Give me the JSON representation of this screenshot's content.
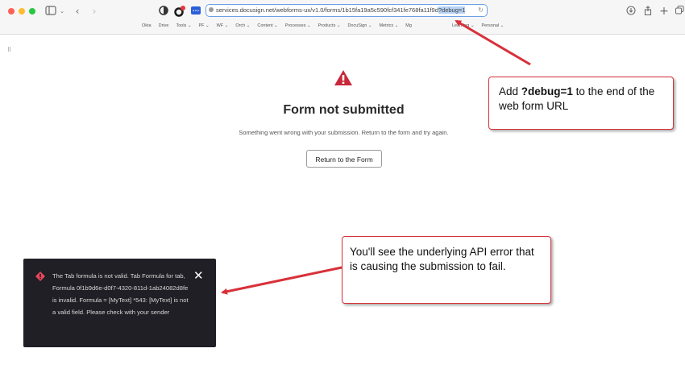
{
  "browser": {
    "url_text": "services.docusign.net/webforms-ux/v1.0/forms/1b15fa19a5c590fcf341fe768fa11f9d",
    "url_highlight": "?debug=1",
    "bookmarks": [
      "Okta",
      "Drive",
      "Tools ⌄",
      "PF ⌄",
      "WF ⌄",
      "Orch ⌄",
      "Content ⌄",
      "Processes ⌄",
      "Products ⌄",
      "DocuSign ⌄",
      "Metrics ⌄",
      "Mg",
      "",
      "Learning ⌄",
      "Personal ⌄"
    ],
    "badge_count": "1"
  },
  "page": {
    "title": "Form not submitted",
    "subtitle": "Something went wrong with your submission. Return to the form and try again.",
    "button_label": "Return to the Form"
  },
  "toast": {
    "message": "The Tab formula is not valid. Tab Formula for tab, Formula 0f1b9d6e-d0f7-4320-811d-1ab24082d8fe is invalid. Formula = [MyText] *543: [MyText] is not a valid field. Please check with your sender",
    "close_glyph": "✕"
  },
  "callouts": {
    "url_hint": {
      "prefix": "Add ",
      "bold": "?debug=1",
      "suffix": " to the end of the web form URL"
    },
    "error_hint": "You'll see the underlying API error that is causing the submission to fail."
  },
  "colors": {
    "accent_red": "#d8313a",
    "toast_bg": "#1f1f25",
    "url_border": "#6aa0e6"
  }
}
